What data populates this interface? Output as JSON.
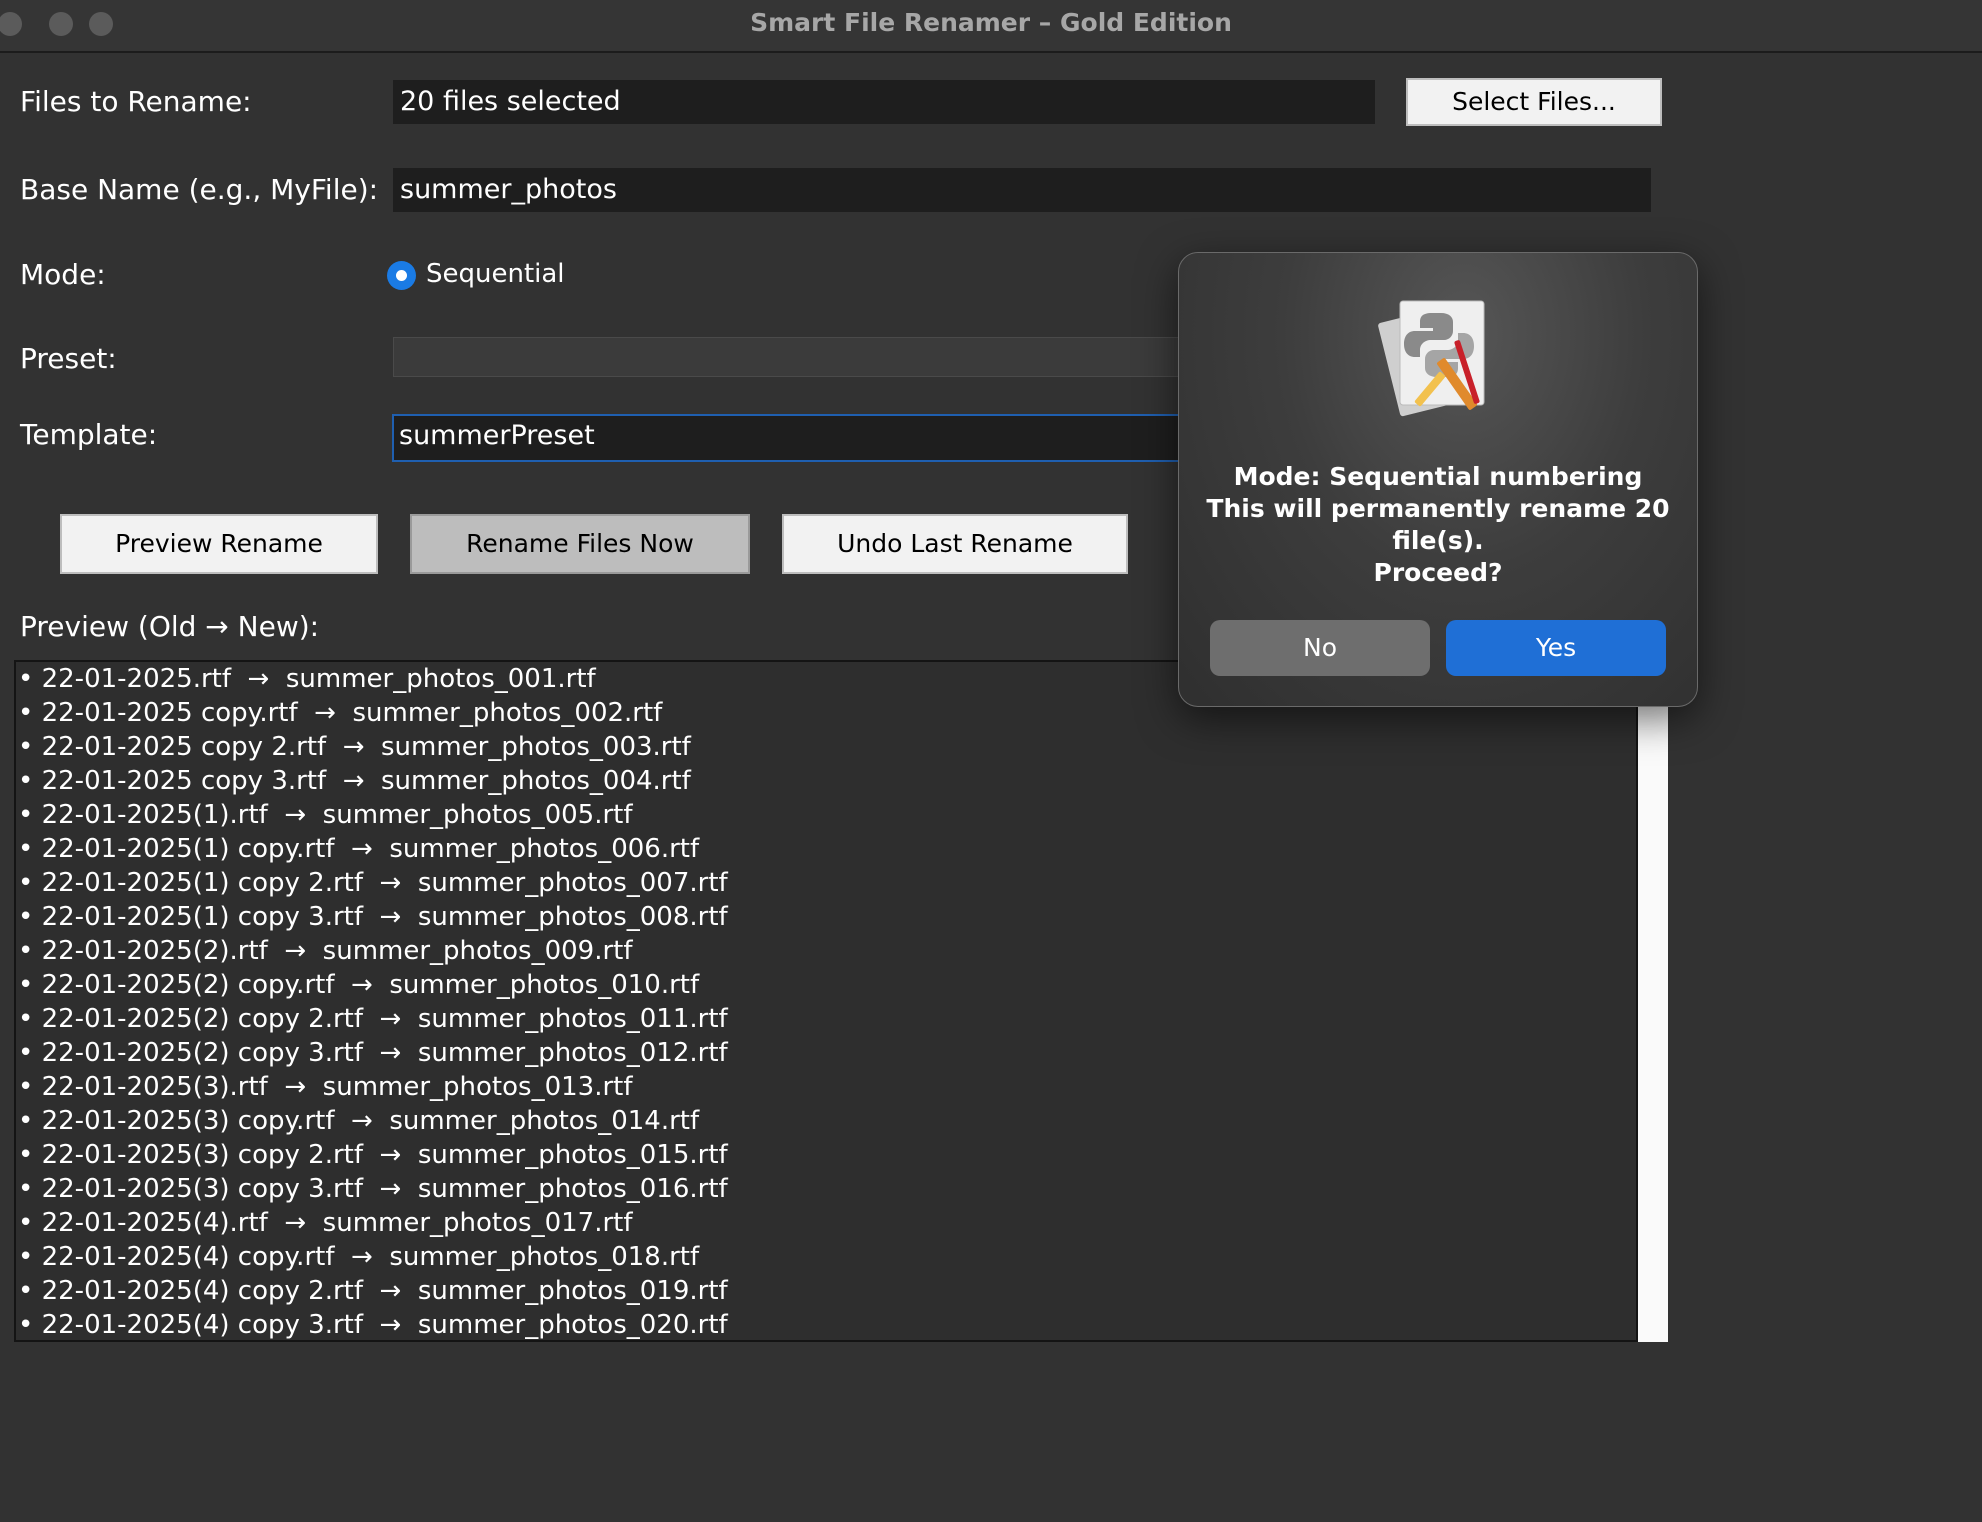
{
  "window": {
    "title": "Smart File Renamer – Gold Edition"
  },
  "form": {
    "files_label": "Files to Rename:",
    "files_value": "20 files selected",
    "select_files_button": "Select Files...",
    "base_name_label": "Base Name (e.g., MyFile):",
    "base_name_value": "summer_photos",
    "mode_label": "Mode:",
    "mode_option": "Sequential",
    "preset_label": "Preset:",
    "preset_value": "",
    "template_label": "Template:",
    "template_value": "summerPreset"
  },
  "actions": {
    "preview": "Preview Rename",
    "rename": "Rename Files Now",
    "undo": "Undo Last Rename"
  },
  "preview": {
    "label": "Preview (Old → New):",
    "rows": [
      "• 22-01-2025.rtf  →  summer_photos_001.rtf",
      "• 22-01-2025 copy.rtf  →  summer_photos_002.rtf",
      "• 22-01-2025 copy 2.rtf  →  summer_photos_003.rtf",
      "• 22-01-2025 copy 3.rtf  →  summer_photos_004.rtf",
      "• 22-01-2025(1).rtf  →  summer_photos_005.rtf",
      "• 22-01-2025(1) copy.rtf  →  summer_photos_006.rtf",
      "• 22-01-2025(1) copy 2.rtf  →  summer_photos_007.rtf",
      "• 22-01-2025(1) copy 3.rtf  →  summer_photos_008.rtf",
      "• 22-01-2025(2).rtf  →  summer_photos_009.rtf",
      "• 22-01-2025(2) copy.rtf  →  summer_photos_010.rtf",
      "• 22-01-2025(2) copy 2.rtf  →  summer_photos_011.rtf",
      "• 22-01-2025(2) copy 3.rtf  →  summer_photos_012.rtf",
      "• 22-01-2025(3).rtf  →  summer_photos_013.rtf",
      "• 22-01-2025(3) copy.rtf  →  summer_photos_014.rtf",
      "• 22-01-2025(3) copy 2.rtf  →  summer_photos_015.rtf",
      "• 22-01-2025(3) copy 3.rtf  →  summer_photos_016.rtf",
      "• 22-01-2025(4).rtf  →  summer_photos_017.rtf",
      "• 22-01-2025(4) copy.rtf  →  summer_photos_018.rtf",
      "• 22-01-2025(4) copy 2.rtf  →  summer_photos_019.rtf",
      "• 22-01-2025(4) copy 3.rtf  →  summer_photos_020.rtf"
    ]
  },
  "dialog": {
    "icon": "python-app-icon",
    "line1": "Mode: Sequential numbering",
    "line2": "This will permanently rename 20",
    "line3": "file(s).",
    "line4": "Proceed?",
    "no_label": "No",
    "yes_label": "Yes"
  },
  "colors": {
    "accent": "#1a7be5",
    "window_bg": "#323232",
    "field_bg": "#1e1e1e"
  }
}
